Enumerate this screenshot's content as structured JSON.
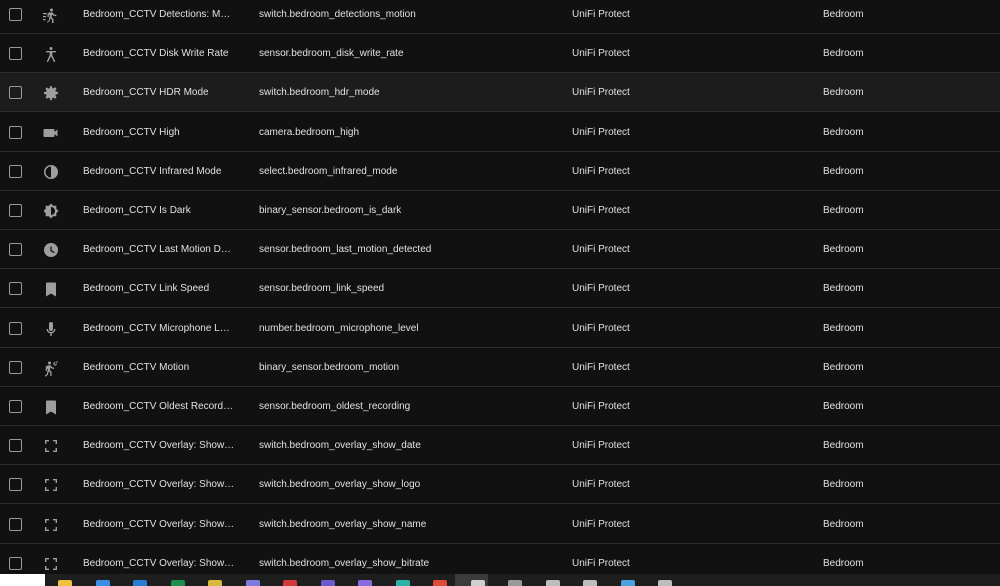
{
  "entities": [
    {
      "icon": "motion-detection-icon",
      "name": "Bedroom_CCTV Detections: Motion",
      "entity_id": "switch.bedroom_detections_motion",
      "integration": "UniFi Protect",
      "area": "Bedroom"
    },
    {
      "icon": "disk-write-icon",
      "name": "Bedroom_CCTV Disk Write Rate",
      "entity_id": "sensor.bedroom_disk_write_rate",
      "integration": "UniFi Protect",
      "area": "Bedroom"
    },
    {
      "icon": "gear-icon",
      "name": "Bedroom_CCTV HDR Mode",
      "entity_id": "switch.bedroom_hdr_mode",
      "integration": "UniFi Protect",
      "area": "Bedroom"
    },
    {
      "icon": "video-camera-icon",
      "name": "Bedroom_CCTV High",
      "entity_id": "camera.bedroom_high",
      "integration": "UniFi Protect",
      "area": "Bedroom"
    },
    {
      "icon": "infrared-icon",
      "name": "Bedroom_CCTV Infrared Mode",
      "entity_id": "select.bedroom_infrared_mode",
      "integration": "UniFi Protect",
      "area": "Bedroom"
    },
    {
      "icon": "brightness-icon",
      "name": "Bedroom_CCTV Is Dark",
      "entity_id": "binary_sensor.bedroom_is_dark",
      "integration": "UniFi Protect",
      "area": "Bedroom"
    },
    {
      "icon": "clock-icon",
      "name": "Bedroom_CCTV Last Motion Dete…",
      "entity_id": "sensor.bedroom_last_motion_detected",
      "integration": "UniFi Protect",
      "area": "Bedroom"
    },
    {
      "icon": "bookmark-icon",
      "name": "Bedroom_CCTV Link Speed",
      "entity_id": "sensor.bedroom_link_speed",
      "integration": "UniFi Protect",
      "area": "Bedroom"
    },
    {
      "icon": "microphone-icon",
      "name": "Bedroom_CCTV Microphone Level",
      "entity_id": "number.bedroom_microphone_level",
      "integration": "UniFi Protect",
      "area": "Bedroom"
    },
    {
      "icon": "motion-sensor-icon",
      "name": "Bedroom_CCTV Motion",
      "entity_id": "binary_sensor.bedroom_motion",
      "integration": "UniFi Protect",
      "area": "Bedroom"
    },
    {
      "icon": "bookmark-icon",
      "name": "Bedroom_CCTV Oldest Recording",
      "entity_id": "sensor.bedroom_oldest_recording",
      "integration": "UniFi Protect",
      "area": "Bedroom"
    },
    {
      "icon": "fullscreen-icon",
      "name": "Bedroom_CCTV Overlay: Show Date",
      "entity_id": "switch.bedroom_overlay_show_date",
      "integration": "UniFi Protect",
      "area": "Bedroom"
    },
    {
      "icon": "fullscreen-icon",
      "name": "Bedroom_CCTV Overlay: Show Lo…",
      "entity_id": "switch.bedroom_overlay_show_logo",
      "integration": "UniFi Protect",
      "area": "Bedroom"
    },
    {
      "icon": "fullscreen-icon",
      "name": "Bedroom_CCTV Overlay: Show Na…",
      "entity_id": "switch.bedroom_overlay_show_name",
      "integration": "UniFi Protect",
      "area": "Bedroom"
    },
    {
      "icon": "fullscreen-icon",
      "name": "Bedroom_CCTV Overlay: Show Ne…",
      "entity_id": "switch.bedroom_overlay_show_bitrate",
      "integration": "UniFi Protect",
      "area": "Bedroom"
    }
  ],
  "highlighted_row": 2,
  "colors": {
    "background": "#111111",
    "row_highlight": "#1c1c1c",
    "divider": "#2c2c2c",
    "text": "#e1e1e1",
    "icon": "#9e9e9e"
  },
  "taskbar": {
    "apps": [
      {
        "icon": "explorer-icon",
        "color": "#f0c040"
      },
      {
        "icon": "store-icon",
        "color": "#3a8ee6"
      },
      {
        "icon": "mail-icon",
        "color": "#2a7bd4"
      },
      {
        "icon": "sheets-icon",
        "color": "#1e8e4e"
      },
      {
        "icon": "app-yellow-icon",
        "color": "#d8b93a"
      },
      {
        "icon": "phone-icon",
        "color": "#7a7ae0"
      },
      {
        "icon": "app-red-icon",
        "color": "#d03a3a"
      },
      {
        "icon": "teams-icon",
        "color": "#6a5acd"
      },
      {
        "icon": "app-purple-icon",
        "color": "#8a6ae0"
      },
      {
        "icon": "edge-icon",
        "color": "#2bb3a8"
      },
      {
        "icon": "chrome-icon",
        "color": "#e04a3a"
      },
      {
        "icon": "notepad-icon",
        "color": "#cfcfcf"
      },
      {
        "icon": "terminal-icon",
        "color": "#9a9a9a"
      },
      {
        "icon": "tools-icon",
        "color": "#bdbdbd"
      },
      {
        "icon": "app-gray-icon",
        "color": "#bdbdbd"
      },
      {
        "icon": "network-icon",
        "color": "#4aa0e0"
      },
      {
        "icon": "settings-icon",
        "color": "#bdbdbd"
      }
    ]
  }
}
